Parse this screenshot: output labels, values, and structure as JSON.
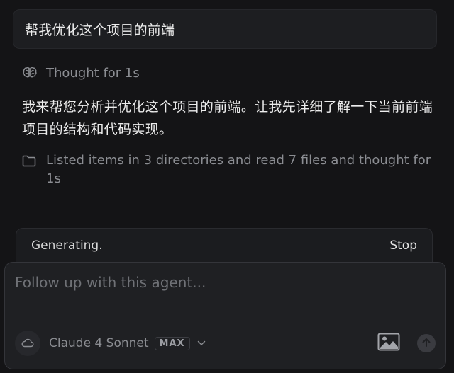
{
  "user_message": "帮我优化这个项目的前端",
  "thought": {
    "icon": "brain-icon",
    "label": "Thought for 1s"
  },
  "assistant_response": "我来帮您分析并优化这个项目的前端。让我先详细了解一下当前前端项目的结构和代码实现。",
  "tool_summary": {
    "icon": "folder-icon",
    "text": "Listed items in 3 directories and read 7 files and thought for 1s"
  },
  "status": {
    "text": "Generating.",
    "stop_label": "Stop"
  },
  "composer": {
    "placeholder": "Follow up with this agent...",
    "value": "",
    "mode_icon": "cloud-icon",
    "model_name": "Claude 4 Sonnet",
    "model_badge": "MAX",
    "dropdown_icon": "chevron-down-icon",
    "image_icon": "image-icon",
    "send_icon": "arrow-up-icon"
  },
  "colors": {
    "background": "#141416",
    "panel": "#1f2023",
    "muted_text": "#8b8d92",
    "primary_text": "#ededed"
  }
}
